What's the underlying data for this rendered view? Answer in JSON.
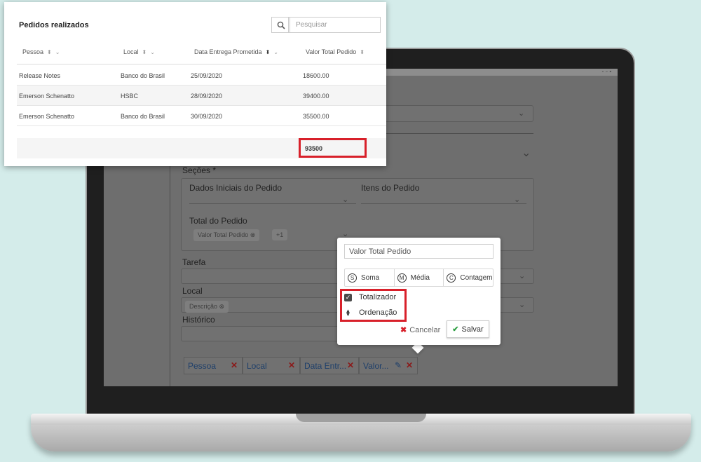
{
  "orders": {
    "title": "Pedidos realizados",
    "search_placeholder": "Pesquisar",
    "columns": [
      "Pessoa",
      "Local",
      "Data Entrega Prometida",
      "Valor Total Pedido"
    ],
    "rows": [
      {
        "pessoa": "Release Notes",
        "local": "Banco do Brasil",
        "data": "25/09/2020",
        "valor": "18600.00"
      },
      {
        "pessoa": "Emerson Schenatto",
        "local": "HSBC",
        "data": "28/09/2020",
        "valor": "39400.00"
      },
      {
        "pessoa": "Emerson Schenatto",
        "local": "Banco do Brasil",
        "data": "30/09/2020",
        "valor": "35500.00"
      }
    ],
    "total": "93500"
  },
  "form": {
    "sections_label": "Seções *",
    "section_dados": "Dados Iniciais do Pedido",
    "section_itens": "Itens do Pedido",
    "section_total": "Total do Pedido",
    "total_chip": "Valor Total Pedido",
    "total_chip_count": "+1",
    "tarefa_label": "Tarefa",
    "local_label": "Local",
    "local_chip": "Descrição",
    "historico_label": "Histórico",
    "columns": [
      "Pessoa",
      "Local",
      "Data Entr...",
      "Valor..."
    ]
  },
  "popup": {
    "field_value": "Valor Total Pedido",
    "aggregations": [
      {
        "letter": "S",
        "label": "Soma"
      },
      {
        "letter": "M",
        "label": "Média"
      },
      {
        "letter": "C",
        "label": "Contagem"
      }
    ],
    "totalizer_label": "Totalizador",
    "ordering_label": "Ordenação",
    "cancel_label": "Cancelar",
    "save_label": "Salvar"
  },
  "colors": {
    "highlight": "#d8202a",
    "save_check": "#2ea043",
    "cancel_x": "#d8202a"
  }
}
